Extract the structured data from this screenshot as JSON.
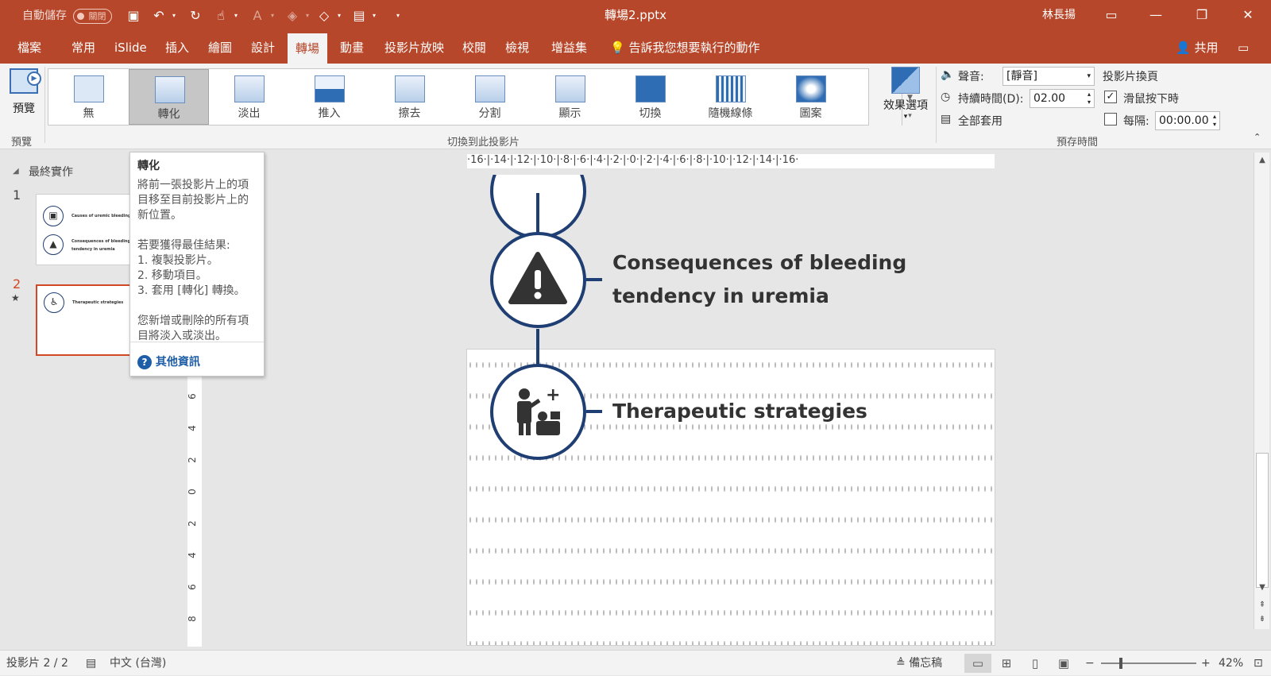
{
  "titlebar": {
    "autosave": "自動儲存",
    "autosave_state": "關閉",
    "doc_title": "轉場2.pptx",
    "user": "林長揚"
  },
  "tabs": [
    "檔案",
    "常用",
    "iSlide",
    "插入",
    "繪圖",
    "設計",
    "轉場",
    "動畫",
    "投影片放映",
    "校閱",
    "檢視",
    "增益集"
  ],
  "tell_me": "告訴我您想要執行的動作",
  "share": "共用",
  "ribbon": {
    "preview": "預覽",
    "preview_group": "預覽",
    "gallery": [
      "無",
      "轉化",
      "淡出",
      "推入",
      "擦去",
      "分割",
      "顯示",
      "切換",
      "隨機線條",
      "圖案"
    ],
    "gallery_group": "切換到此投影片",
    "effect_options": "效果選項",
    "sound_label": "聲音:",
    "sound_value": "[靜音]",
    "duration_label": "持續時間(D):",
    "duration_value": "02.00",
    "apply_all": "全部套用",
    "advance_label": "投影片換頁",
    "on_click": "滑鼠按下時",
    "after_label": "每隔:",
    "after_value": "00:00.00",
    "timing_group": "預存時間"
  },
  "thumbs": {
    "section": "最終實作",
    "n1": "1",
    "n2": "2",
    "t1a": "Causes of uremic bleeding",
    "t1b": "Consequences of bleeding",
    "t1c": "tendency in uremia",
    "t2a": "Therapeutic strategies"
  },
  "tooltip": {
    "title": "轉化",
    "l1": "將前一張投影片上的項",
    "l2": "目移至目前投影片上的",
    "l3": "新位置。",
    "l4": "若要獲得最佳結果:",
    "l5": "1. 複製投影片。",
    "l6": "2. 移動項目。",
    "l7": "3. 套用 [轉化] 轉換。",
    "l8": "您新增或刪除的所有項",
    "l9": "目將淡入或淡出。",
    "more": "其他資訊"
  },
  "ruler": "·16·|·14·|·12·|·10·|·8·|·6·|·4·|·2·|·0·|·2·|·4·|·6·|·8·|·10·|·12·|·14·|·16·",
  "vruler": [
    "6",
    "4",
    "2",
    "0",
    "2",
    "4",
    "6",
    "8"
  ],
  "slide": {
    "heading1a": "Consequences of bleeding",
    "heading1b": "tendency in uremia",
    "heading2": "Therapeutic strategies"
  },
  "status": {
    "slide": "投影片 2 / 2",
    "lang": "中文 (台灣)",
    "notes": "備忘稿",
    "zoom": "42%"
  },
  "colors": {
    "accent": "#b7472a",
    "line": "#1f3e73"
  }
}
